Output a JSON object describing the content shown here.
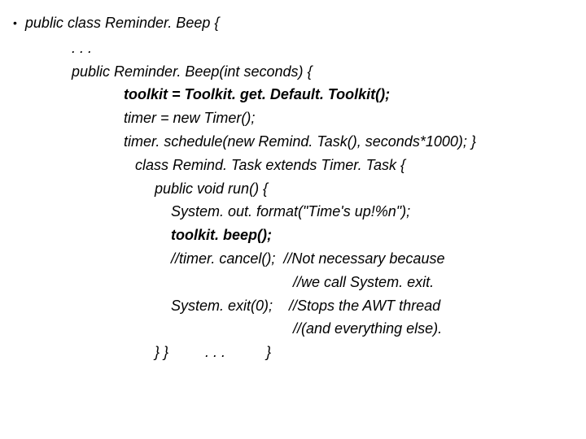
{
  "lines": {
    "l0": "public class Reminder. Beep {",
    "l1": ". . .",
    "l2": "public Reminder. Beep(int seconds) {",
    "l3": "toolkit = Toolkit. get. Default. Toolkit();",
    "l4": "timer = new Timer();",
    "l5": "timer. schedule(new Remind. Task(), seconds*1000); }",
    "l6": "class Remind. Task extends Timer. Task {",
    "l7": "public void run() {",
    "l8": "System. out. format(\"Time's up!%n\");",
    "l9": "toolkit. beep();",
    "l10": "//timer. cancel();  //Not necessary because",
    "l11": "                              //we call System. exit.",
    "l12": "System. exit(0);    //Stops the AWT thread",
    "l13": "                              //(and everything else).",
    "l14": "} }         . . .          }"
  }
}
